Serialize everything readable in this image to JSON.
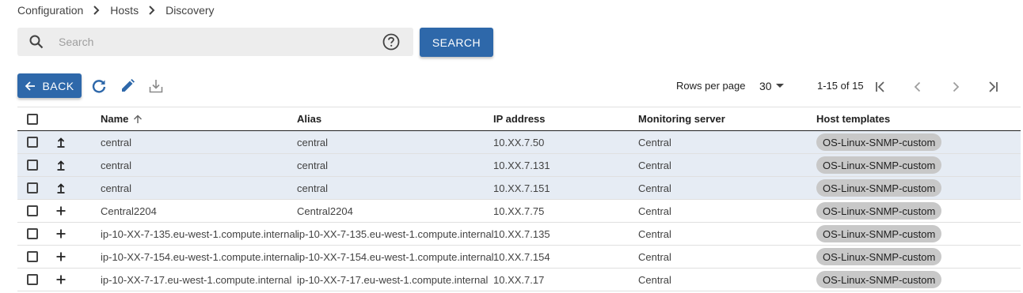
{
  "breadcrumb": [
    "Configuration",
    "Hosts",
    "Discovery"
  ],
  "search": {
    "placeholder": "Search",
    "value": "",
    "button_label": "SEARCH"
  },
  "toolbar": {
    "back_label": "BACK",
    "icons": [
      "refresh-icon",
      "edit-icon",
      "download-icon"
    ]
  },
  "pagination": {
    "rows_per_page_label": "Rows per page",
    "rows_per_page_value": "30",
    "range": "1-15 of 15"
  },
  "table": {
    "columns": {
      "name": "Name",
      "alias": "Alias",
      "ip": "IP address",
      "monitoring": "Monitoring server",
      "templates": "Host templates"
    },
    "sort": {
      "column": "Name",
      "direction": "ascending"
    },
    "rows": [
      {
        "action": "update",
        "selected": true,
        "name": "central",
        "alias": "central",
        "ip": "10.XX.7.50",
        "monitoring": "Central",
        "template": "OS-Linux-SNMP-custom"
      },
      {
        "action": "update",
        "selected": true,
        "name": "central",
        "alias": "central",
        "ip": "10.XX.7.131",
        "monitoring": "Central",
        "template": "OS-Linux-SNMP-custom"
      },
      {
        "action": "update",
        "selected": true,
        "name": "central",
        "alias": "central",
        "ip": "10.XX.7.151",
        "monitoring": "Central",
        "template": "OS-Linux-SNMP-custom"
      },
      {
        "action": "add",
        "selected": false,
        "name": "Central2204",
        "alias": "Central2204",
        "ip": "10.XX.7.75",
        "monitoring": "Central",
        "template": "OS-Linux-SNMP-custom"
      },
      {
        "action": "add",
        "selected": false,
        "name": "ip-10-XX-7-135.eu-west-1.compute.internal",
        "alias": "ip-10-XX-7-135.eu-west-1.compute.internal",
        "ip": "10.XX.7.135",
        "monitoring": "Central",
        "template": "OS-Linux-SNMP-custom"
      },
      {
        "action": "add",
        "selected": false,
        "name": "ip-10-XX-7-154.eu-west-1.compute.internal",
        "alias": "ip-10-XX-7-154.eu-west-1.compute.internal",
        "ip": "10.XX.7.154",
        "monitoring": "Central",
        "template": "OS-Linux-SNMP-custom"
      },
      {
        "action": "add",
        "selected": false,
        "name": "ip-10-XX-7-17.eu-west-1.compute.internal",
        "alias": "ip-10-XX-7-17.eu-west-1.compute.internal",
        "ip": "10.XX.7.17",
        "monitoring": "Central",
        "template": "OS-Linux-SNMP-custom"
      }
    ]
  },
  "colors": {
    "primary": "#2e68aa",
    "selected_row": "#e6ecf4",
    "chip": "#c8c8c8"
  }
}
